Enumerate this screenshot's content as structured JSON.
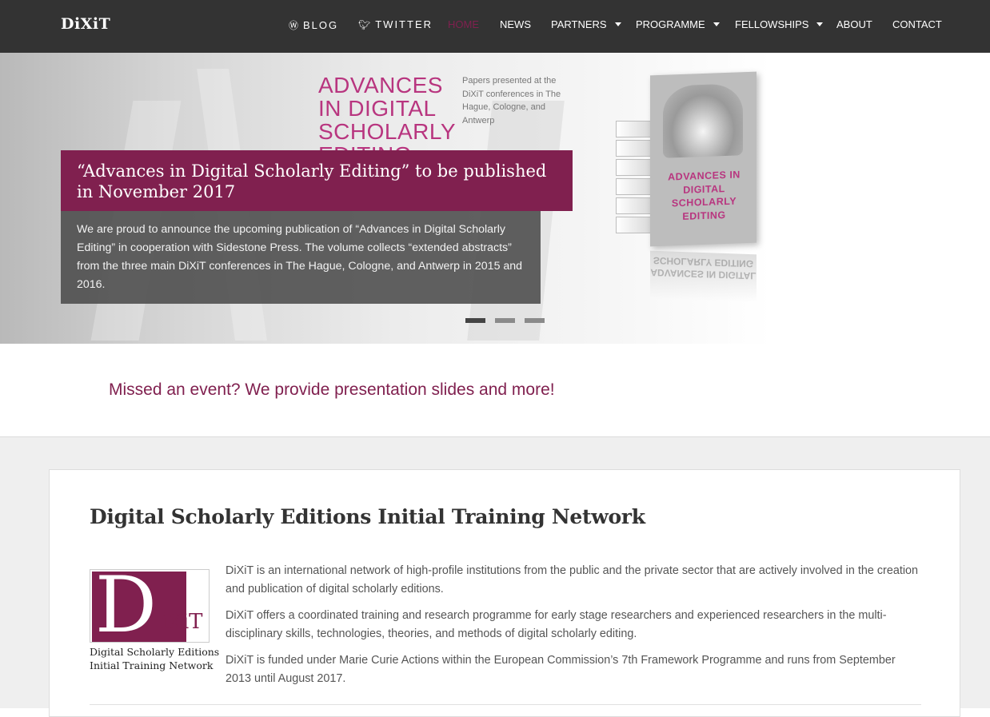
{
  "nav": {
    "brand": "DiXiT",
    "items": [
      {
        "label": "BLOG",
        "icon": "wordpress-icon"
      },
      {
        "label": "TWITTER",
        "icon": "twitter-icon"
      },
      {
        "label": "HOME",
        "active": true
      },
      {
        "label": "NEWS"
      },
      {
        "label": "PARTNERS",
        "dropdown": true
      },
      {
        "label": "PROGRAMME",
        "dropdown": true
      },
      {
        "label": "FELLOWSHIPS",
        "dropdown": true
      },
      {
        "label": "ABOUT"
      },
      {
        "label": "CONTACT"
      }
    ]
  },
  "hero": {
    "image_headline": "ADVANCES IN DIGITAL SCHOLARLY EDITING",
    "image_subtitle": "Papers presented at the DiXiT conferences in The Hague, Cologne, and Antwerp",
    "book_title": "ADVANCES IN DIGITAL SCHOLARLY EDITING",
    "slide_title": "“Advances in Digital Scholarly Editing” to be published in November 2017",
    "slide_text": "We are proud to announce the upcoming publication of “Advances in Digital Scholarly Editing” in cooperation with Sidestone Press. The volume collects “extended abstracts” from the three main DiXiT conferences in The Hague, Cologne, and Antwerp in 2015 and 2016.",
    "slide_count": 3,
    "active_slide": 1
  },
  "callout": {
    "text": "Missed an event? We provide presentation slides and more!"
  },
  "main": {
    "title": "Digital Scholarly Editions Initial Training Network",
    "logo": {
      "letter": "D",
      "rest": "iXiT",
      "line1": "Digital Scholarly Editions",
      "line2": "Initial Training Network"
    },
    "paragraphs": [
      "DiXiT is an international network of high-profile institutions from the public and the private sector that are actively involved in the creation and publication of digital scholarly editions.",
      "DiXiT offers a coordinated training and research programme for early stage researchers and experienced researchers in the multi-disciplinary skills, technologies, theories, and methods of digital scholarly editing.",
      "DiXiT is funded under Marie Curie Actions within the European Commission’s 7th Framework Programme and runs from September 2013 until August 2017."
    ]
  },
  "colors": {
    "accent": "#80204f",
    "nav_bg": "#333333",
    "hero_pink": "#b8357f",
    "page_bg": "#efefef"
  }
}
